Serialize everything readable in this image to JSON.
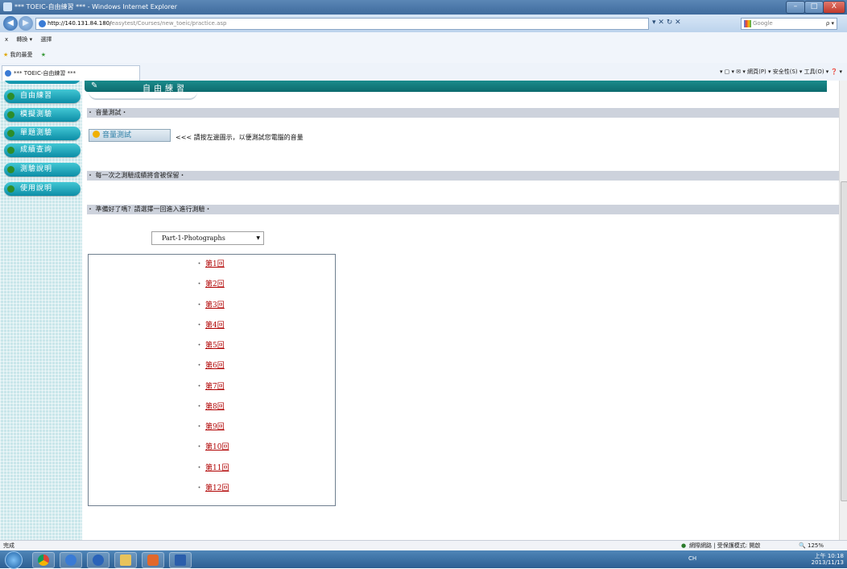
{
  "window": {
    "title": "*** TOEIC-自由練習 *** - Windows Internet Explorer",
    "min": "–",
    "max": "□",
    "close": "X"
  },
  "address": {
    "url_host": "http://140.131.84.180/",
    "url_path": "easytest/Courses/new_toeic/practice.asp",
    "nav_back": "◀",
    "nav_fwd": "▶",
    "tools": "▾  ✕  ↻  ✕",
    "search_placeholder": "Google",
    "search_icon": "ρ ▾"
  },
  "menubar": {
    "close": "x",
    "items": [
      "轉換 ▾",
      "選擇"
    ]
  },
  "favbar": {
    "favorites": "我的最愛"
  },
  "tab": {
    "title": "*** TOEIC-自由練習 ***"
  },
  "commandbar": "▾  ▢  ▾  ✉  ▾  網頁(P) ▾  安全性(S) ▾  工具(O) ▾  ❓ ▾",
  "sidebar": {
    "items": [
      "自由練習",
      "模擬測驗",
      "單題測驗",
      "成績查詢",
      "測驗說明",
      "使用說明"
    ]
  },
  "header": {
    "title": "自由練習"
  },
  "sections": {
    "volume": "・ 音量測試・",
    "record": "・ 每一次之測驗成績將會被保留・",
    "ready": "・ 準備好了嗎？請選擇一回進入進行測驗・"
  },
  "volume_button": "音量測試",
  "volume_hint": "<<< 請按左邊圖示，以便測試您電腦的音量",
  "part_select": {
    "value": "Part-1-Photographs"
  },
  "rounds": [
    "第1回",
    "第2回",
    "第3回",
    "第4回",
    "第5回",
    "第6回",
    "第7回",
    "第8回",
    "第9回",
    "第10回",
    "第11回",
    "第12回"
  ],
  "statusbar": {
    "left": "完成",
    "zone": "網際網路 | 受保護模式: 開啟",
    "zoom": "125%"
  },
  "taskbar": {
    "time": "上午 10:18",
    "date": "2013/11/13",
    "lang": "CH"
  }
}
